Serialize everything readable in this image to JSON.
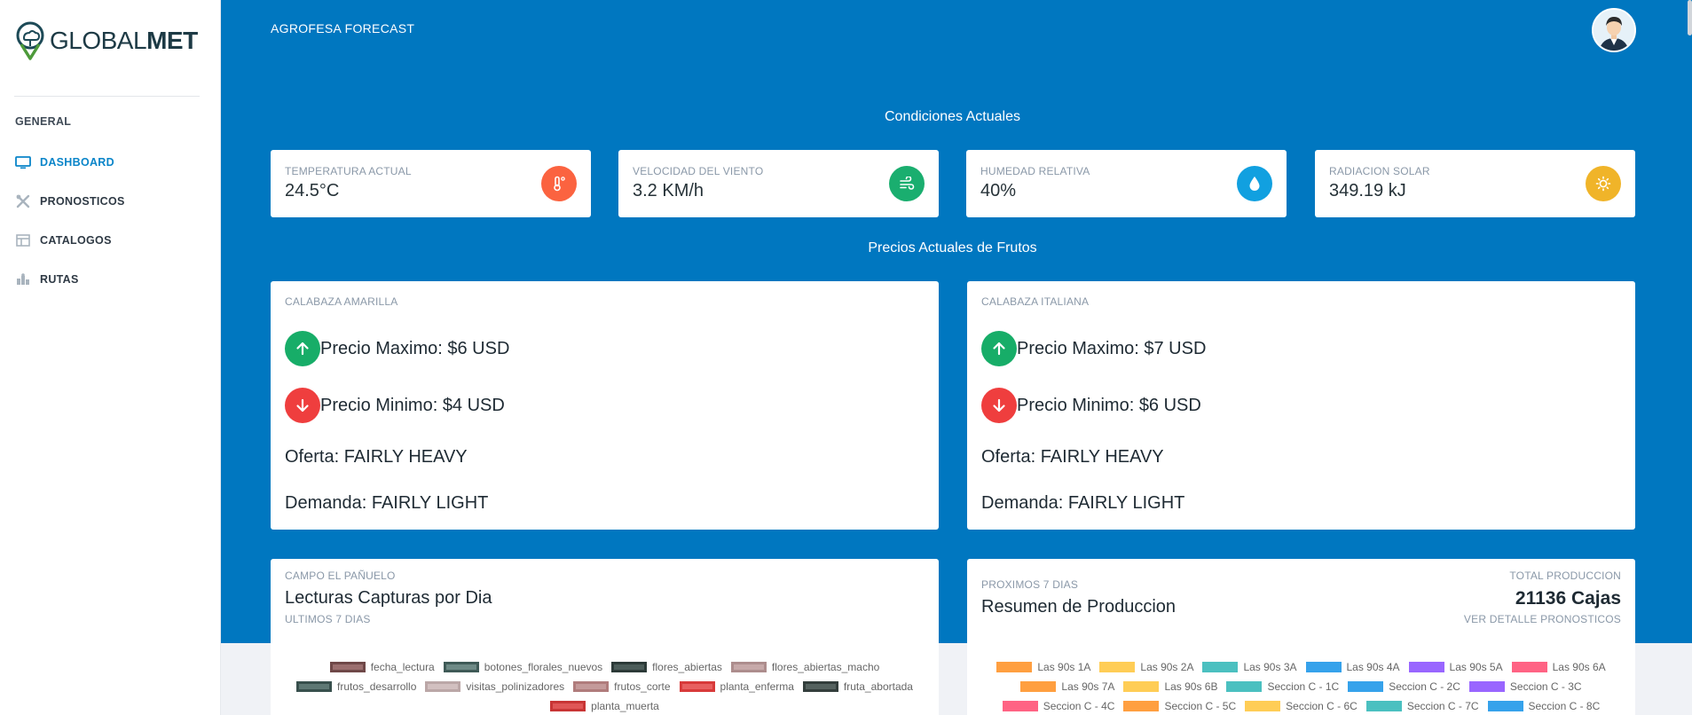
{
  "brand": {
    "name_light": "GLOBAL",
    "name_bold": "MET"
  },
  "sidebar": {
    "section": "GENERAL",
    "items": [
      {
        "label": "DASHBOARD",
        "icon": "monitor-icon",
        "active": true
      },
      {
        "label": "PRONOSTICOS",
        "icon": "tools-icon",
        "active": false
      },
      {
        "label": "CATALOGOS",
        "icon": "table-icon",
        "active": false
      },
      {
        "label": "RUTAS",
        "icon": "map-icon",
        "active": false
      }
    ]
  },
  "header": {
    "title": "AGROFESA FORECAST"
  },
  "conditions": {
    "title": "Condiciones Actuales",
    "cards": [
      {
        "label": "TEMPERATURA ACTUAL",
        "value": "24.5°C",
        "icon": "thermometer-icon",
        "color": "#fb6340"
      },
      {
        "label": "VELOCIDAD DEL VIENTO",
        "value": "3.2 KM/h",
        "icon": "wind-icon",
        "color": "#1aae6f"
      },
      {
        "label": "HUMEDAD RELATIVA",
        "value": "40%",
        "icon": "droplet-icon",
        "color": "#11a0e0"
      },
      {
        "label": "RADIACION SOLAR",
        "value": "349.19 kJ",
        "icon": "sun-icon",
        "color": "#f0b429"
      }
    ]
  },
  "prices": {
    "title": "Precios Actuales de Frutos",
    "cards": [
      {
        "name": "CALABAZA AMARILLA",
        "max": "Precio Maximo: $6 USD",
        "min": "Precio Minimo: $4 USD",
        "oferta": "Oferta: FAIRLY HEAVY",
        "demanda": "Demanda: FAIRLY LIGHT"
      },
      {
        "name": "CALABAZA ITALIANA",
        "max": "Precio Maximo: $7 USD",
        "min": "Precio Minimo: $6 USD",
        "oferta": "Oferta: FAIRLY HEAVY",
        "demanda": "Demanda: FAIRLY LIGHT"
      }
    ],
    "up_color": "#17ad68",
    "down_color": "#ef3e3e"
  },
  "captures": {
    "kicker": "CAMPO EL PAÑUELO",
    "title": "Lecturas Capturas por Dia",
    "subtitle": "ULTIMOS 7 DIAS",
    "legend": [
      {
        "label": "fecha_lectura",
        "fill": "#9b6f6f",
        "stroke": "#6f4848"
      },
      {
        "label": "botones_florales_nuevos",
        "fill": "#6e8a86",
        "stroke": "#3f5a57"
      },
      {
        "label": "flores_abiertas",
        "fill": "#4c5d5a",
        "stroke": "#2c3a38"
      },
      {
        "label": "flores_abiertas_macho",
        "fill": "#c7a9a9",
        "stroke": "#ad8d8d"
      },
      {
        "label": "frutos_desarrollo",
        "fill": "#5e7874",
        "stroke": "#38504d"
      },
      {
        "label": "visitas_polinizadores",
        "fill": "#d2c0c0",
        "stroke": "#bba7a7"
      },
      {
        "label": "frutos_corte",
        "fill": "#c49a9a",
        "stroke": "#b07c7c"
      },
      {
        "label": "planta_enferma",
        "fill": "#e86060",
        "stroke": "#d83a3a"
      },
      {
        "label": "fruta_abortada",
        "fill": "#55625f",
        "stroke": "#333e3c"
      },
      {
        "label": "planta_muerta",
        "fill": "#e05656",
        "stroke": "#c83535"
      }
    ]
  },
  "production": {
    "kicker": "PROXIMOS 7 DIAS",
    "title": "Resumen de Produccion",
    "total_label": "TOTAL PRODUCCION",
    "total_value": "21136 Cajas",
    "link": "VER DETALLE PRONOSTICOS",
    "legend": [
      {
        "label": "Las 90s 1A",
        "fill": "#ff9f40"
      },
      {
        "label": "Las 90s 2A",
        "fill": "#ffcd56"
      },
      {
        "label": "Las 90s 3A",
        "fill": "#4bc0c0"
      },
      {
        "label": "Las 90s 4A",
        "fill": "#36a2eb"
      },
      {
        "label": "Las 90s 5A",
        "fill": "#9966ff"
      },
      {
        "label": "Las 90s 6A",
        "fill": "#ff6384"
      },
      {
        "label": "Las 90s 7A",
        "fill": "#ff9f40"
      },
      {
        "label": "Las 90s 6B",
        "fill": "#ffcd56"
      },
      {
        "label": "Seccion C - 1C",
        "fill": "#4bc0c0"
      },
      {
        "label": "Seccion C - 2C",
        "fill": "#36a2eb"
      },
      {
        "label": "Seccion C - 3C",
        "fill": "#9966ff"
      },
      {
        "label": "Seccion C - 4C",
        "fill": "#ff6384"
      },
      {
        "label": "Seccion C - 5C",
        "fill": "#ff9f40"
      },
      {
        "label": "Seccion C - 6C",
        "fill": "#ffcd56"
      },
      {
        "label": "Seccion C - 7C",
        "fill": "#4bc0c0"
      },
      {
        "label": "Seccion C - 8C",
        "fill": "#36a2eb"
      }
    ]
  }
}
